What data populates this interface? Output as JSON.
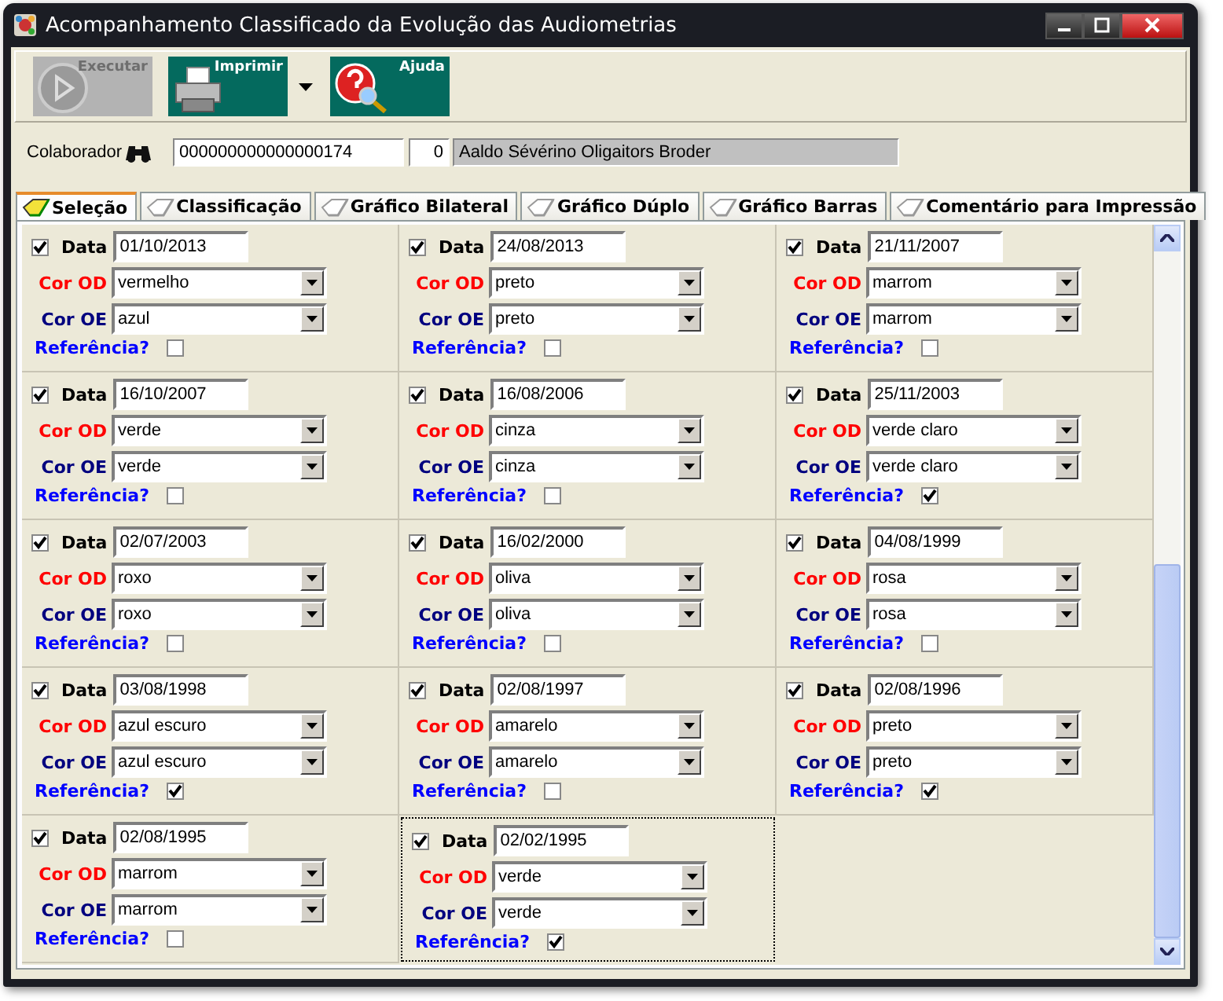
{
  "window": {
    "title": "Acompanhamento Classificado da Evolução das Audiometrias"
  },
  "toolbar": [
    {
      "label": "Executar",
      "kind": "run",
      "disabled": true,
      "dropdown": false
    },
    {
      "label": "Imprimir",
      "kind": "print",
      "disabled": false,
      "dropdown": true
    },
    {
      "label": "Ajuda",
      "kind": "help",
      "disabled": false,
      "dropdown": false
    }
  ],
  "colaborador": {
    "label": "Colaborador",
    "code": "000000000000000174",
    "number": "0",
    "name": "Aaldo Sévérino Oligaitors Broder"
  },
  "tabs": [
    {
      "label": "Seleção",
      "selected": true
    },
    {
      "label": "Classificação",
      "selected": false
    },
    {
      "label": "Gráfico Bilateral",
      "selected": false
    },
    {
      "label": "Gráfico Dúplo",
      "selected": false
    },
    {
      "label": "Gráfico Barras",
      "selected": false
    },
    {
      "label": "Comentário para Impressão",
      "selected": false
    }
  ],
  "records": [
    {
      "checked": true,
      "data_label": "Data",
      "date": "01/10/2013",
      "od_label": "Cor OD",
      "od": "vermelho",
      "oe_label": "Cor OE",
      "oe": "azul",
      "ref_label": "Referência?",
      "reference": false,
      "selected": false
    },
    {
      "checked": true,
      "data_label": "Data",
      "date": "24/08/2013",
      "od_label": "Cor OD",
      "od": "preto",
      "oe_label": "Cor OE",
      "oe": "preto",
      "ref_label": "Referência?",
      "reference": false,
      "selected": false
    },
    {
      "checked": true,
      "data_label": "Data",
      "date": "21/11/2007",
      "od_label": "Cor OD",
      "od": "marrom",
      "oe_label": "Cor OE",
      "oe": "marrom",
      "ref_label": "Referência?",
      "reference": false,
      "selected": false
    },
    {
      "checked": true,
      "data_label": "Data",
      "date": "16/10/2007",
      "od_label": "Cor OD",
      "od": "verde",
      "oe_label": "Cor OE",
      "oe": "verde",
      "ref_label": "Referência?",
      "reference": false,
      "selected": false
    },
    {
      "checked": true,
      "data_label": "Data",
      "date": "16/08/2006",
      "od_label": "Cor OD",
      "od": "cinza",
      "oe_label": "Cor OE",
      "oe": "cinza",
      "ref_label": "Referência?",
      "reference": false,
      "selected": false
    },
    {
      "checked": true,
      "data_label": "Data",
      "date": "25/11/2003",
      "od_label": "Cor OD",
      "od": "verde claro",
      "oe_label": "Cor OE",
      "oe": "verde claro",
      "ref_label": "Referência?",
      "reference": true,
      "selected": false
    },
    {
      "checked": true,
      "data_label": "Data",
      "date": "02/07/2003",
      "od_label": "Cor OD",
      "od": "roxo",
      "oe_label": "Cor OE",
      "oe": "roxo",
      "ref_label": "Referência?",
      "reference": false,
      "selected": false
    },
    {
      "checked": true,
      "data_label": "Data",
      "date": "16/02/2000",
      "od_label": "Cor OD",
      "od": "oliva",
      "oe_label": "Cor OE",
      "oe": "oliva",
      "ref_label": "Referência?",
      "reference": false,
      "selected": false
    },
    {
      "checked": true,
      "data_label": "Data",
      "date": "04/08/1999",
      "od_label": "Cor OD",
      "od": "rosa",
      "oe_label": "Cor OE",
      "oe": "rosa",
      "ref_label": "Referência?",
      "reference": false,
      "selected": false
    },
    {
      "checked": true,
      "data_label": "Data",
      "date": "03/08/1998",
      "od_label": "Cor OD",
      "od": "azul escuro",
      "oe_label": "Cor OE",
      "oe": "azul escuro",
      "ref_label": "Referência?",
      "reference": true,
      "selected": false
    },
    {
      "checked": true,
      "data_label": "Data",
      "date": "02/08/1997",
      "od_label": "Cor OD",
      "od": "amarelo",
      "oe_label": "Cor OE",
      "oe": "amarelo",
      "ref_label": "Referência?",
      "reference": false,
      "selected": false
    },
    {
      "checked": true,
      "data_label": "Data",
      "date": "02/08/1996",
      "od_label": "Cor OD",
      "od": "preto",
      "oe_label": "Cor OE",
      "oe": "preto",
      "ref_label": "Referência?",
      "reference": true,
      "selected": false
    },
    {
      "checked": true,
      "data_label": "Data",
      "date": "02/08/1995",
      "od_label": "Cor OD",
      "od": "marrom",
      "oe_label": "Cor OE",
      "oe": "marrom",
      "ref_label": "Referência?",
      "reference": false,
      "selected": false
    },
    {
      "checked": true,
      "data_label": "Data",
      "date": "02/02/1995",
      "od_label": "Cor OD",
      "od": "verde",
      "oe_label": "Cor OE",
      "oe": "verde",
      "ref_label": "Referência?",
      "reference": true,
      "selected": true
    }
  ]
}
